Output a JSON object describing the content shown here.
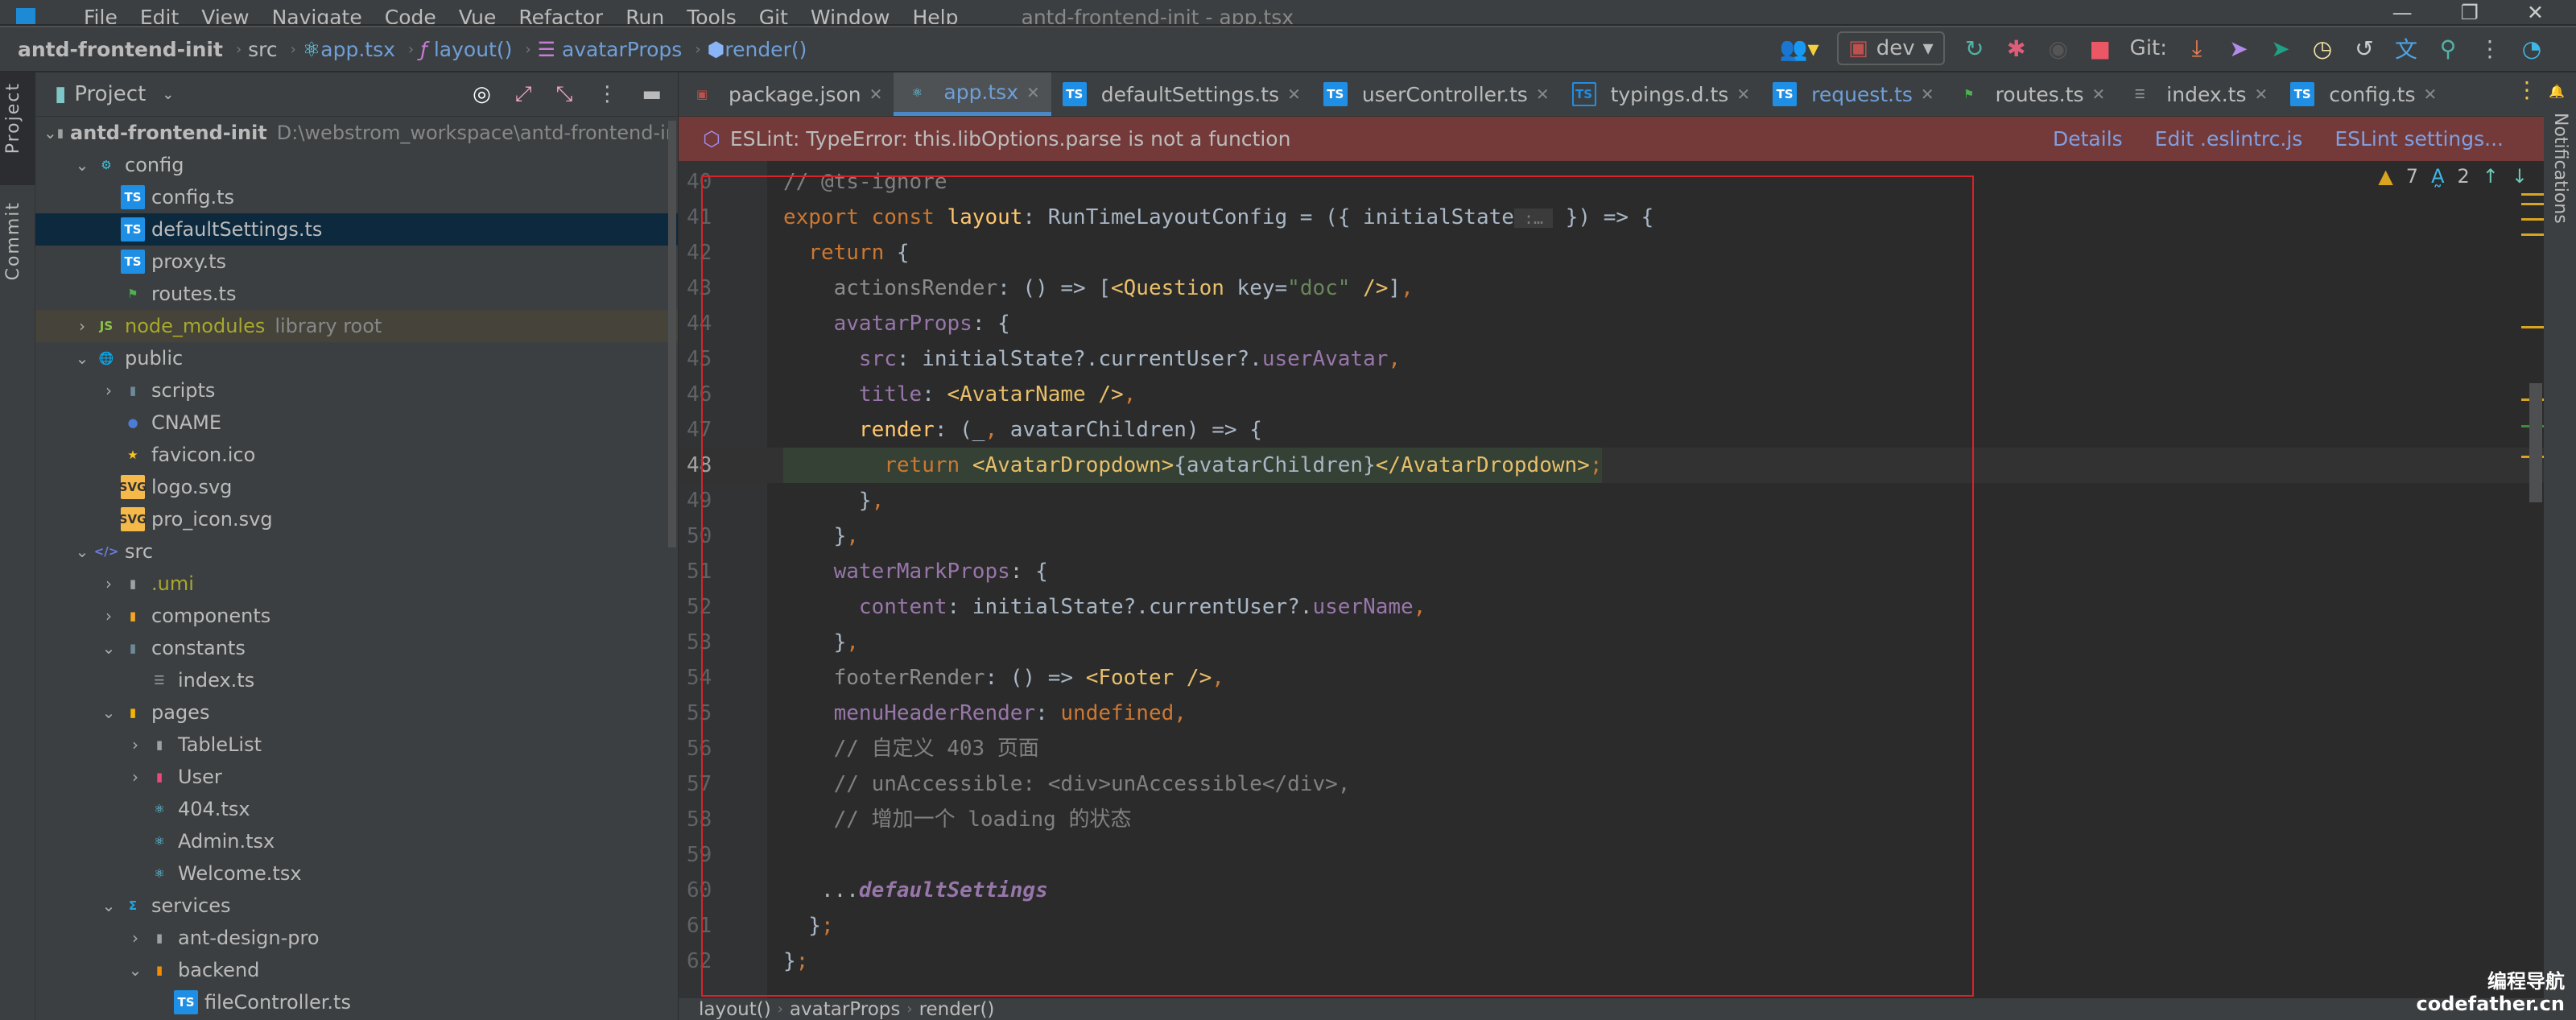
{
  "window": {
    "title": "antd-frontend-init - app.tsx",
    "menu": [
      "File",
      "Edit",
      "View",
      "Navigate",
      "Code",
      "Vue",
      "Refactor",
      "Run",
      "Tools",
      "Git",
      "Window",
      "Help"
    ]
  },
  "nav": {
    "project": "antd-frontend-init",
    "crumbs": [
      "src",
      "app.tsx",
      "layout()",
      "avatarProps",
      "render()"
    ]
  },
  "toolbar": {
    "branch": "dev",
    "git_label": "Git:"
  },
  "leftstrip": {
    "project": "Project",
    "commit": "Commit"
  },
  "project_panel": {
    "title": "Project"
  },
  "tree": [
    {
      "label": "antd-frontend-init",
      "hint": "D:\\webstrom_workspace\\antd-frontend-init",
      "depth": 0,
      "arrow": "v",
      "icon": "folder",
      "bold": true
    },
    {
      "label": "config",
      "depth": 1,
      "arrow": "v",
      "icon": "folder-config"
    },
    {
      "label": "config.ts",
      "depth": 2,
      "icon": "ts"
    },
    {
      "label": "defaultSettings.ts",
      "depth": 2,
      "icon": "ts",
      "selected": true
    },
    {
      "label": "proxy.ts",
      "depth": 2,
      "icon": "ts"
    },
    {
      "label": "routes.ts",
      "depth": 2,
      "icon": "routes"
    },
    {
      "label": "node_modules",
      "hint": "library root",
      "depth": 1,
      "arrow": ">",
      "icon": "folder-node",
      "library": true
    },
    {
      "label": "public",
      "depth": 1,
      "arrow": "v",
      "icon": "folder-public"
    },
    {
      "label": "scripts",
      "depth": 2,
      "arrow": ">",
      "icon": "folder-scripts"
    },
    {
      "label": "CNAME",
      "depth": 2,
      "icon": "globe"
    },
    {
      "label": "favicon.ico",
      "depth": 2,
      "icon": "star"
    },
    {
      "label": "logo.svg",
      "depth": 2,
      "icon": "svg"
    },
    {
      "label": "pro_icon.svg",
      "depth": 2,
      "icon": "svg"
    },
    {
      "label": "src",
      "depth": 1,
      "arrow": "v",
      "icon": "folder-src"
    },
    {
      "label": ".umi",
      "depth": 2,
      "arrow": ">",
      "icon": "folder",
      "excluded": true
    },
    {
      "label": "components",
      "depth": 2,
      "arrow": ">",
      "icon": "folder-components"
    },
    {
      "label": "constants",
      "depth": 2,
      "arrow": "v",
      "icon": "folder-constants"
    },
    {
      "label": "index.ts",
      "depth": 3,
      "icon": "index"
    },
    {
      "label": "pages",
      "depth": 2,
      "arrow": "v",
      "icon": "folder-pages"
    },
    {
      "label": "TableList",
      "depth": 3,
      "arrow": ">",
      "icon": "folder"
    },
    {
      "label": "User",
      "depth": 3,
      "arrow": ">",
      "icon": "folder-user"
    },
    {
      "label": "404.tsx",
      "depth": 3,
      "icon": "react"
    },
    {
      "label": "Admin.tsx",
      "depth": 3,
      "icon": "react"
    },
    {
      "label": "Welcome.tsx",
      "depth": 3,
      "icon": "react"
    },
    {
      "label": "services",
      "depth": 2,
      "arrow": "v",
      "icon": "folder-services"
    },
    {
      "label": "ant-design-pro",
      "depth": 3,
      "arrow": ">",
      "icon": "folder"
    },
    {
      "label": "backend",
      "depth": 3,
      "arrow": "v",
      "icon": "folder-backend"
    },
    {
      "label": "fileController.ts",
      "depth": 4,
      "icon": "ts"
    }
  ],
  "tabs": [
    {
      "label": "package.json",
      "icon": "npm"
    },
    {
      "label": "app.tsx",
      "icon": "react",
      "active": true
    },
    {
      "label": "defaultSettings.ts",
      "icon": "ts"
    },
    {
      "label": "userController.ts",
      "icon": "ts"
    },
    {
      "label": "typings.d.ts",
      "icon": "ts-outline"
    },
    {
      "label": "request.ts",
      "icon": "ts",
      "modified": true
    },
    {
      "label": "routes.ts",
      "icon": "routes"
    },
    {
      "label": "index.ts",
      "icon": "index"
    },
    {
      "label": "config.ts",
      "icon": "ts"
    }
  ],
  "eslint": {
    "message": "ESLint: TypeError: this.libOptions.parse is not a function",
    "links": [
      "Details",
      "Edit .eslintrc.js",
      "ESLint settings..."
    ]
  },
  "inspections": {
    "warnings": "7",
    "typos": "2"
  },
  "code": {
    "current_line": 48,
    "lines": [
      {
        "n": "40",
        "t": [
          [
            "// @ts-ignore",
            "cm"
          ]
        ]
      },
      {
        "n": "41",
        "t": [
          [
            "export const ",
            "kw"
          ],
          [
            "layout",
            "fn"
          ],
          [
            ": RunTimeLayoutConfig = ({ initialState",
            "id"
          ],
          [
            " :… ",
            "hint"
          ],
          [
            " }) => {",
            "id"
          ]
        ]
      },
      {
        "n": "42",
        "t": [
          [
            "  return ",
            "kw"
          ],
          [
            "{",
            "id"
          ]
        ]
      },
      {
        "n": "43",
        "t": [
          [
            "    actionsRender",
            "dim"
          ],
          [
            ": () => [",
            "id"
          ],
          [
            "<Question ",
            "tag"
          ],
          [
            "key",
            "id"
          ],
          [
            "=",
            "id"
          ],
          [
            "\"doc\"",
            "str"
          ],
          [
            " />",
            "tag"
          ],
          [
            "]",
            "id"
          ],
          [
            ",",
            "kw"
          ]
        ]
      },
      {
        "n": "44",
        "t": [
          [
            "    avatarProps",
            "prop"
          ],
          [
            ": {",
            "id"
          ]
        ]
      },
      {
        "n": "45",
        "t": [
          [
            "      src",
            "prop"
          ],
          [
            ": initialState?.currentUser?.",
            "id"
          ],
          [
            "userAvatar",
            "prop"
          ],
          [
            ",",
            "kw"
          ]
        ]
      },
      {
        "n": "46",
        "t": [
          [
            "      title",
            "prop"
          ],
          [
            ": ",
            "id"
          ],
          [
            "<AvatarName />",
            "tag"
          ],
          [
            ",",
            "kw"
          ]
        ]
      },
      {
        "n": "47",
        "t": [
          [
            "      render",
            "fn"
          ],
          [
            ": (_",
            "id"
          ],
          [
            ",",
            "kw"
          ],
          [
            " avatarChildren) => {",
            "id"
          ]
        ]
      },
      {
        "n": "48",
        "t": [
          [
            "        ",
            "id"
          ],
          [
            "return ",
            "kw"
          ],
          [
            "<AvatarDropdown>",
            "tag"
          ],
          [
            "{avatarChildren}",
            "id"
          ],
          [
            "</AvatarDropdown>",
            "tag"
          ],
          [
            ";",
            "kw"
          ]
        ]
      },
      {
        "n": "49",
        "t": [
          [
            "      }",
            "id"
          ],
          [
            ",",
            "kw"
          ]
        ]
      },
      {
        "n": "50",
        "t": [
          [
            "    }",
            "id"
          ],
          [
            ",",
            "kw"
          ]
        ]
      },
      {
        "n": "51",
        "t": [
          [
            "    waterMarkProps",
            "prop"
          ],
          [
            ": {",
            "id"
          ]
        ]
      },
      {
        "n": "52",
        "t": [
          [
            "      content",
            "prop"
          ],
          [
            ": initialState?.currentUser?.",
            "id"
          ],
          [
            "userName",
            "prop"
          ],
          [
            ",",
            "kw"
          ]
        ]
      },
      {
        "n": "53",
        "t": [
          [
            "    }",
            "id"
          ],
          [
            ",",
            "kw"
          ]
        ]
      },
      {
        "n": "54",
        "t": [
          [
            "    footerRender",
            "dim"
          ],
          [
            ": () => ",
            "id"
          ],
          [
            "<Footer />",
            "tag"
          ],
          [
            ",",
            "kw"
          ]
        ]
      },
      {
        "n": "55",
        "t": [
          [
            "    menuHeaderRender",
            "prop"
          ],
          [
            ": ",
            "id"
          ],
          [
            "undefined",
            "kw"
          ],
          [
            ",",
            "kw"
          ]
        ]
      },
      {
        "n": "56",
        "t": [
          [
            "    // 自定义 403 页面",
            "cm"
          ]
        ]
      },
      {
        "n": "57",
        "t": [
          [
            "    // unAccessible: <div>unAccessible</div>,",
            "cm"
          ]
        ]
      },
      {
        "n": "58",
        "t": [
          [
            "    // 增加一个 loading 的状态",
            "cm"
          ]
        ]
      },
      {
        "n": "59",
        "t": []
      },
      {
        "n": "60",
        "t": [
          [
            "   ...",
            "id"
          ],
          [
            "defaultSettings",
            "it"
          ]
        ]
      },
      {
        "n": "61",
        "t": [
          [
            "  }",
            "id"
          ],
          [
            ";",
            "kw"
          ]
        ]
      },
      {
        "n": "62",
        "t": [
          [
            "}",
            "id"
          ],
          [
            ";",
            "kw"
          ]
        ]
      }
    ]
  },
  "footer": {
    "crumbs": [
      "layout()",
      "avatarProps",
      "render()"
    ]
  },
  "rightstrip": {
    "label": "Notifications"
  },
  "watermark": {
    "line1": "编程导航",
    "line2": "codefather.cn"
  },
  "colors": {
    "accent": "#4a88c7",
    "error_banner": "#743a3a",
    "selection": "#0d293e",
    "highlight_box": "#d8232a"
  }
}
